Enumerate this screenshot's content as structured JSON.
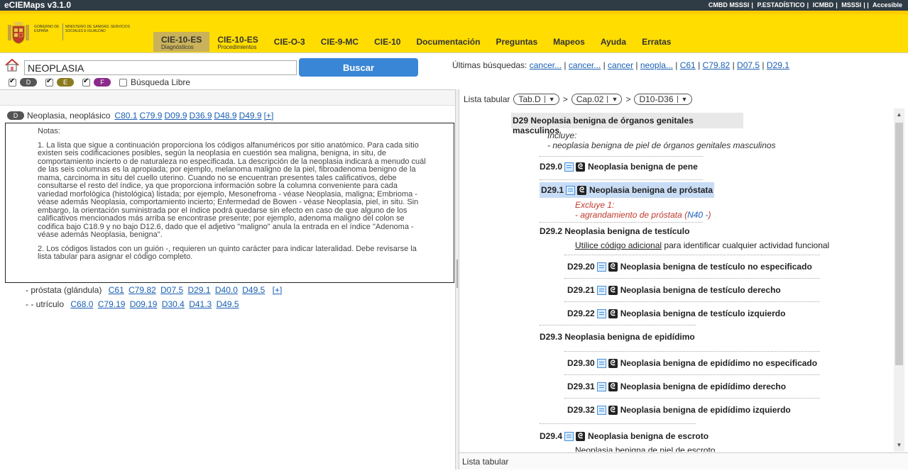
{
  "app": {
    "title": "eCIEMaps v3.1.0"
  },
  "top_links": [
    "CMBD MSSSI",
    "P.ESTADÍSTICO",
    "ICMBD",
    "MSSSI",
    "Accesible"
  ],
  "gov": {
    "line1": "GOBIERNO DE ESPAÑA",
    "line2": "MINISTERIO DE SANIDAD, SERVICIOS SOCIALES E IGUALDAD"
  },
  "nav": [
    {
      "main": "CIE-10-ES",
      "sub": "Diagnósticos"
    },
    {
      "main": "CIE-10-ES",
      "sub": "Procedimientos"
    },
    {
      "main": "CIE-O-3"
    },
    {
      "main": "CIE-9-MC"
    },
    {
      "main": "CIE-10"
    },
    {
      "main": "Documentación"
    },
    {
      "main": "Preguntas"
    },
    {
      "main": "Mapeos"
    },
    {
      "main": "Ayuda"
    },
    {
      "main": "Erratas"
    }
  ],
  "search": {
    "value": "NEOPLASIA",
    "button": "Buscar",
    "filters": [
      "D",
      "E",
      "F"
    ],
    "libre_label": "Búsqueda Libre"
  },
  "recent": {
    "label": "Últimas búsquedas:",
    "items": [
      "cancer...",
      "cancer...",
      "cancer",
      "neopla...",
      "C61",
      "C79.82",
      "D07.5",
      "D29.1"
    ]
  },
  "left": {
    "entry": {
      "badge": "D",
      "term": "Neoplasia, neoplásico",
      "codes": [
        "C80.1",
        "C79.9",
        "D09.9",
        "D36.9",
        "D48.9",
        "D49.9"
      ],
      "more": "[+]"
    },
    "notes": {
      "title": "Notas:",
      "p1": "1. La lista que sigue a continuación proporciona los códigos alfanuméricos por sitio anatómico. Para cada sitio existen seis codificaciones posibles, según la neoplasia en cuestión sea maligna, benigna, in situ, de comportamiento incierto o de naturaleza no especificada. La descripción de la neoplasia indicará a menudo cuál de las seis columnas es la apropiada; por ejemplo, melanoma maligno de la piel, fibroadenoma benigno de la mama, carcinoma in situ del cuello uterino. Cuando no se encuentran presentes tales calificativos, debe consultarse el resto del índice, ya que proporciona información sobre la columna conveniente para cada variedad morfológica (histológica) listada; por ejemplo, Mesonefroma - véase Neoplasia, maligna; Embrioma - véase además Neoplasia, comportamiento incierto; Enfermedad de Bowen - véase Neoplasia, piel, in situ. Sin embargo, la orientación suministrada por el índice podrá quedarse sin efecto en caso de que alguno de los calificativos mencionados más arriba se encontrase presente; por ejemplo, adenoma maligno del colon se codifica bajo C18.9 y no bajo D12.6, dado que el adjetivo \"maligno\" anula la entrada en el índice \"Adenoma - véase además Neoplasia, benigna\".",
      "p2": "2. Los códigos listados con un guión -, requieren un quinto carácter para indicar lateralidad. Debe revisarse la lista tabular para asignar el código completo."
    },
    "sub1": {
      "term": "- próstata (glándula)",
      "codes": [
        "C61",
        "C79.82",
        "D07.5",
        "D29.1",
        "D40.0",
        "D49.5"
      ],
      "more": "[+]"
    },
    "sub2": {
      "term": "- - utrículo",
      "codes": [
        "C68.0",
        "C79.19",
        "D09.19",
        "D30.4",
        "D41.3",
        "D49.5"
      ]
    }
  },
  "right": {
    "breadcrumb_label": "Lista tabular",
    "crumbs": [
      "Tab.D",
      "Cap.02",
      "D10-D36"
    ],
    "header": "D29 Neoplasia benigna de órganos genitales masculinos",
    "incluye_label": "Incluye:",
    "incluye_item": "- neoplasia benigna de piel de órganos genitales masculinos",
    "rows": [
      {
        "code": "D29.0",
        "text": "Neoplasia benigna de pene"
      },
      {
        "code": "D29.1",
        "text": "Neoplasia benigna de próstata"
      },
      {
        "code": "D29.2",
        "text": "Neoplasia benigna de testículo"
      },
      {
        "code": "D29.20",
        "text": "Neoplasia benigna de testículo no especificado"
      },
      {
        "code": "D29.21",
        "text": "Neoplasia benigna de testículo derecho"
      },
      {
        "code": "D29.22",
        "text": "Neoplasia benigna de testículo izquierdo"
      },
      {
        "code": "D29.3",
        "text": "Neoplasia benigna de epidídimo"
      },
      {
        "code": "D29.30",
        "text": "Neoplasia benigna de epidídimo no especificado"
      },
      {
        "code": "D29.31",
        "text": "Neoplasia benigna de epidídimo derecho"
      },
      {
        "code": "D29.32",
        "text": "Neoplasia benigna de epidídimo izquierdo"
      },
      {
        "code": "D29.4",
        "text": "Neoplasia benigna de escroto"
      }
    ],
    "excluye_label": "Excluye 1:",
    "excluye_item": "- agrandamiento de próstata (",
    "excluye_code": "N40 -",
    "excluye_close": ")",
    "utilice_link": "Utilice código adicional",
    "utilice_rest": " para identificar cualquier actividad funcional",
    "escroto_sub": "Neoplasia benigna de piel de escroto",
    "footer": "Lista tabular"
  },
  "colors": {
    "header_yellow": "#ffdd00",
    "topbar": "#2f3b45",
    "button_blue": "#3a86d6",
    "link": "#1a5fb4"
  }
}
